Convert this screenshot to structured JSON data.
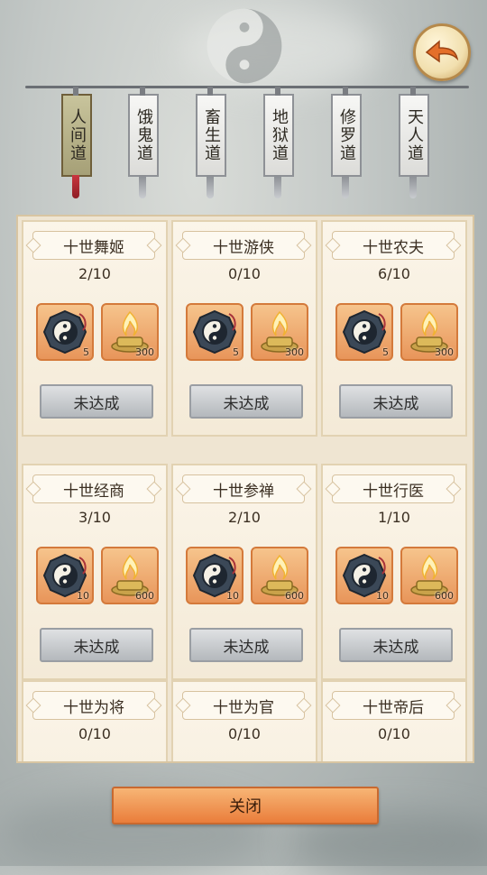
{
  "tabs": [
    {
      "label": "人间道",
      "active": true
    },
    {
      "label": "饿鬼道",
      "active": false
    },
    {
      "label": "畜生道",
      "active": false
    },
    {
      "label": "地狱道",
      "active": false
    },
    {
      "label": "修罗道",
      "active": false
    },
    {
      "label": "天人道",
      "active": false
    }
  ],
  "cards": [
    {
      "title": "十世舞姬",
      "progress": "2/10",
      "rewards": [
        {
          "icon": "bagua-compass-icon",
          "qty": "5"
        },
        {
          "icon": "incense-burner-icon",
          "qty": "300"
        }
      ],
      "status": "未达成"
    },
    {
      "title": "十世游侠",
      "progress": "0/10",
      "rewards": [
        {
          "icon": "bagua-compass-icon",
          "qty": "5"
        },
        {
          "icon": "incense-burner-icon",
          "qty": "300"
        }
      ],
      "status": "未达成"
    },
    {
      "title": "十世农夫",
      "progress": "6/10",
      "rewards": [
        {
          "icon": "bagua-compass-icon",
          "qty": "5"
        },
        {
          "icon": "incense-burner-icon",
          "qty": "300"
        }
      ],
      "status": "未达成"
    },
    {
      "title": "十世经商",
      "progress": "3/10",
      "rewards": [
        {
          "icon": "bagua-compass-icon",
          "qty": "10"
        },
        {
          "icon": "incense-burner-icon",
          "qty": "600"
        }
      ],
      "status": "未达成"
    },
    {
      "title": "十世参禅",
      "progress": "2/10",
      "rewards": [
        {
          "icon": "bagua-compass-icon",
          "qty": "10"
        },
        {
          "icon": "incense-burner-icon",
          "qty": "600"
        }
      ],
      "status": "未达成"
    },
    {
      "title": "十世行医",
      "progress": "1/10",
      "rewards": [
        {
          "icon": "bagua-compass-icon",
          "qty": "10"
        },
        {
          "icon": "incense-burner-icon",
          "qty": "600"
        }
      ],
      "status": "未达成"
    },
    {
      "title": "十世为将",
      "progress": "0/10"
    },
    {
      "title": "十世为官",
      "progress": "0/10"
    },
    {
      "title": "十世帝后",
      "progress": "0/10"
    }
  ],
  "close_label": "关闭",
  "colors": {
    "accent": "#ea7d3b",
    "active_tab": "#a6a077",
    "tassel_active": "#c9363f"
  }
}
